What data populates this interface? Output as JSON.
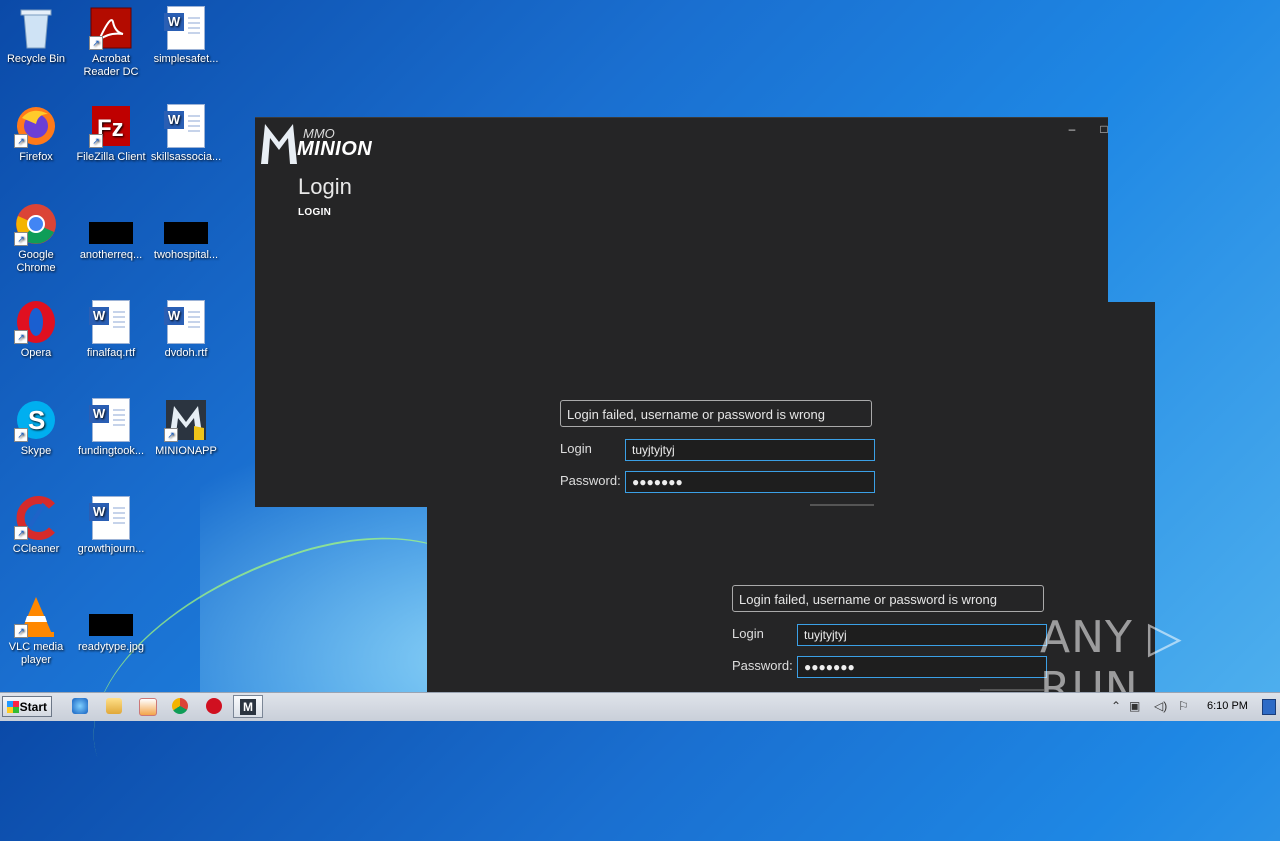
{
  "desktop": {
    "icons": [
      {
        "label": "Recycle Bin"
      },
      {
        "label": "Acrobat Reader DC"
      },
      {
        "label": "simplesafet..."
      },
      {
        "label": "Firefox"
      },
      {
        "label": "FileZilla Client"
      },
      {
        "label": "skillsassocia..."
      },
      {
        "label": "Google Chrome"
      },
      {
        "label": "anotherreq..."
      },
      {
        "label": "twohospital..."
      },
      {
        "label": "Opera"
      },
      {
        "label": "finalfaq.rtf"
      },
      {
        "label": "dvdoh.rtf"
      },
      {
        "label": "Skype"
      },
      {
        "label": "fundingtook..."
      },
      {
        "label": "MINIONAPP"
      },
      {
        "label": "CCleaner"
      },
      {
        "label": "growthjourn..."
      },
      {
        "label": "VLC media player"
      },
      {
        "label": "readytype.jpg"
      }
    ]
  },
  "app1": {
    "logo_small": "MMO",
    "logo_big": "MINION",
    "minimize": "–",
    "maximize": "□",
    "title": "Login",
    "subtitle": "LOGIN",
    "error": "Login failed, username or password is wrong",
    "login_label": "Login",
    "login_value": "tuyjtyjtyj",
    "password_label": "Password:",
    "password_value": "●●●●●●●"
  },
  "app2": {
    "error": "Login failed, username or password is wrong",
    "login_label": "Login",
    "login_value": "tuyjtyjtyj",
    "password_label": "Password:",
    "password_value": "●●●●●●●"
  },
  "taskbar": {
    "start_label": "Start",
    "clock": "6:10 PM"
  },
  "watermark": "ANY ▷ RUN"
}
